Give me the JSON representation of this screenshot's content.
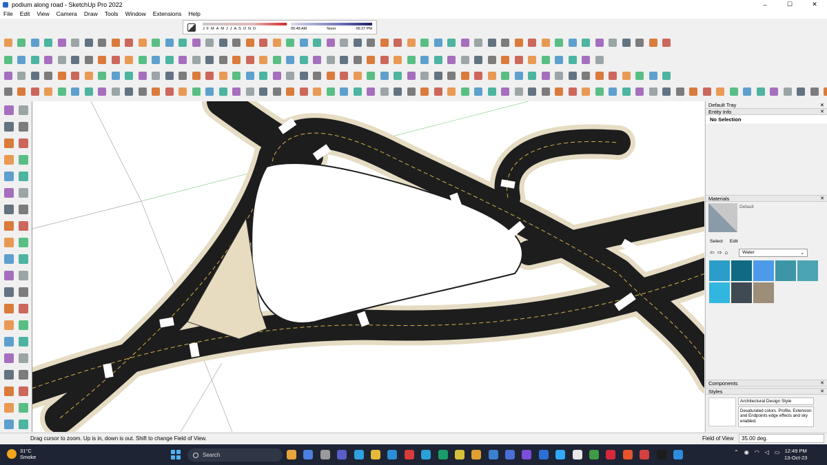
{
  "window": {
    "title": "podium along road - SketchUp Pro 2022",
    "controls": [
      "–",
      "☐",
      "✕"
    ]
  },
  "menu": [
    "File",
    "Edit",
    "View",
    "Camera",
    "Draw",
    "Tools",
    "Window",
    "Extensions",
    "Help"
  ],
  "shadow_settings": {
    "months": [
      "J",
      "F",
      "M",
      "A",
      "M",
      "J",
      "J",
      "A",
      "S",
      "O",
      "N",
      "D"
    ],
    "time_start": "05:48 AM",
    "time_mid": "Noon",
    "time_end": "06:37 PM"
  },
  "tray": {
    "title": "Default Tray",
    "entity_info": {
      "label": "Entity Info",
      "selection": "No Selection"
    },
    "materials": {
      "label": "Materials",
      "current": "Default",
      "tab_select": "Select",
      "tab_edit": "Edit",
      "library": "Water",
      "swatch_colors": [
        "#2a9ec9",
        "#0f6b84",
        "#4d9be8",
        "#3d96a6",
        "#4aa4b2",
        "#31b6e0",
        "#3f4a52",
        "#9c8e78"
      ]
    },
    "components": {
      "label": "Components"
    },
    "styles": {
      "label": "Styles",
      "name": "Architectural Design Style",
      "description": "Desaturated colors. Profile, Extension and Endpoints edge effects and sky enabled."
    }
  },
  "status": {
    "hint": "Drag cursor to zoom.  Up is in, down is out. Shift to change Field of View.",
    "fov_label": "Field of View",
    "fov_value": "35.00 deg."
  },
  "taskbar": {
    "temperature": "31°C",
    "condition": "Smoke",
    "search_placeholder": "Search",
    "time": "12:49 PM",
    "date": "13-Oct-23",
    "app_icon_colors": [
      "#e8a33a",
      "#4c7fe0",
      "#9b9b9b",
      "#5a5ec8",
      "#2fa0e0",
      "#e6b93b",
      "#2a8fd8",
      "#d83b3b",
      "#2aa0d8",
      "#1c9b6a",
      "#d8c13a",
      "#e0a030",
      "#3a7fd0",
      "#4a6fd8",
      "#7a4ed8",
      "#2b6fd8",
      "#31a8ff",
      "#e8e8e8",
      "#3f9b44",
      "#d6283b",
      "#e8542b",
      "#d64040",
      "#1c1c1c",
      "#2d8be0"
    ]
  }
}
